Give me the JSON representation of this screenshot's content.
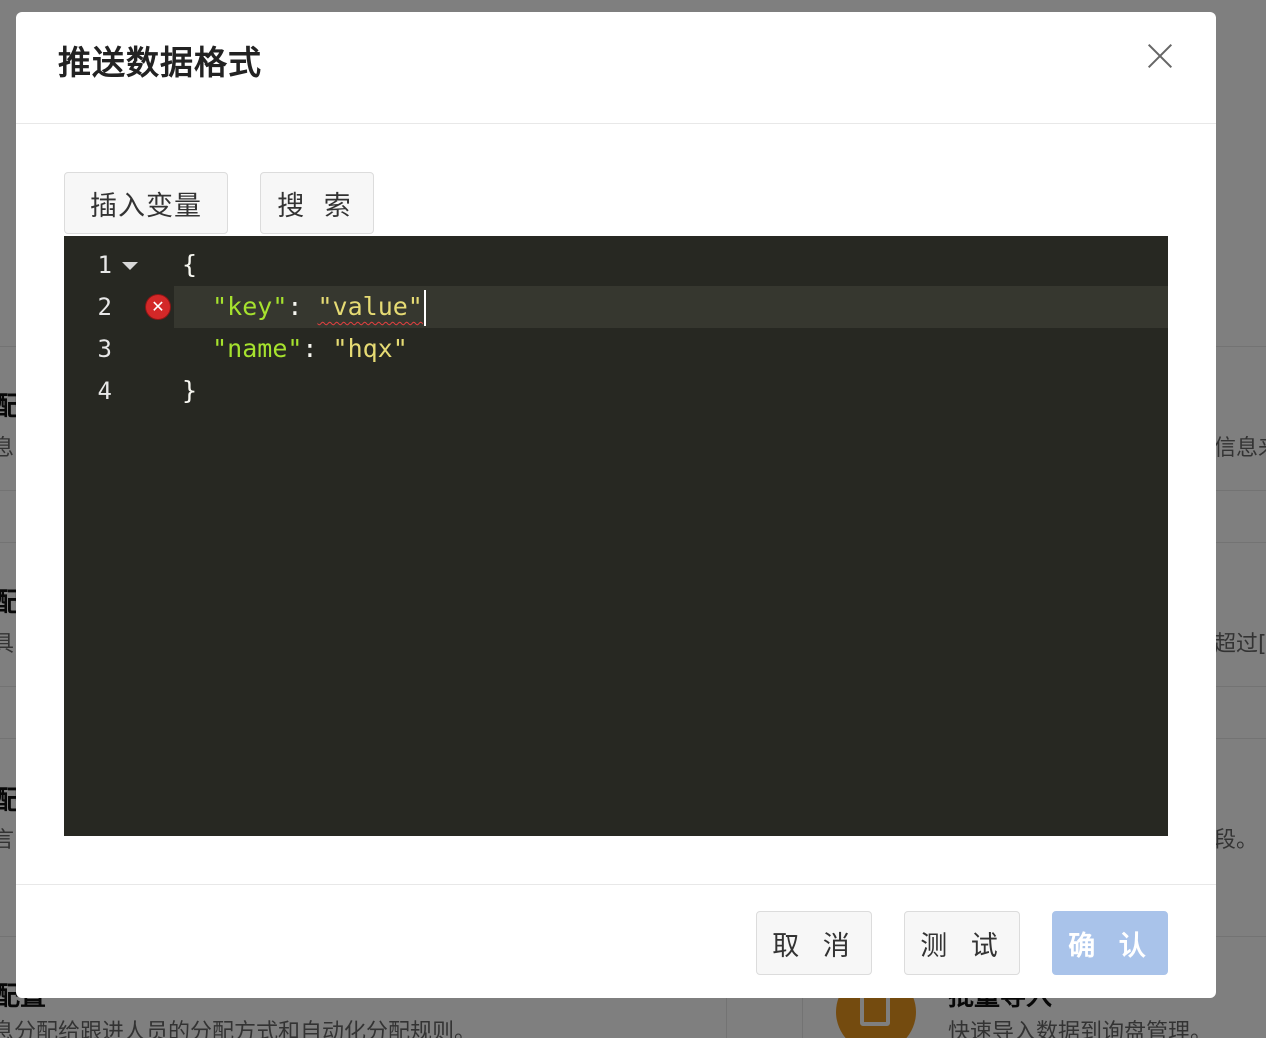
{
  "modal": {
    "title": "推送数据格式",
    "close_icon": "close-icon",
    "toolbar": {
      "insert_variable_label": "插入变量",
      "search_label": "搜 索"
    },
    "editor": {
      "lines": [
        {
          "number": "1",
          "text": "{",
          "fold": true
        },
        {
          "number": "2",
          "key": "\"key\"",
          "colon": ": ",
          "value": "\"value\"",
          "error": true,
          "active": true
        },
        {
          "number": "3",
          "key": "\"name\"",
          "colon": ": ",
          "value": "\"hqx\""
        },
        {
          "number": "4",
          "text": "}"
        }
      ],
      "error_icon": "error-icon",
      "colors": {
        "background": "#272822",
        "key": "#a6e22e",
        "string": "#e6db74"
      }
    },
    "footer": {
      "cancel_label": "取 消",
      "test_label": "测 试",
      "confirm_label": "确 认"
    }
  },
  "background": {
    "fragments": {
      "left_1": "配",
      "left_1_sub": "息",
      "left_2": "配",
      "left_2_sub": "具",
      "left_3": "配",
      "left_3_sub": "言",
      "right_1_sub": "信息来",
      "right_2_sub": "超过[",
      "right_3_sub": "段。",
      "bottom_left_title": "配置",
      "bottom_left_sub": "息分配给跟进人员的分配方式和自动化分配规则。",
      "bottom_right_title": "批量导入",
      "bottom_right_sub": "快速导入数据到询盘管理。"
    },
    "icon": "import-icon"
  }
}
